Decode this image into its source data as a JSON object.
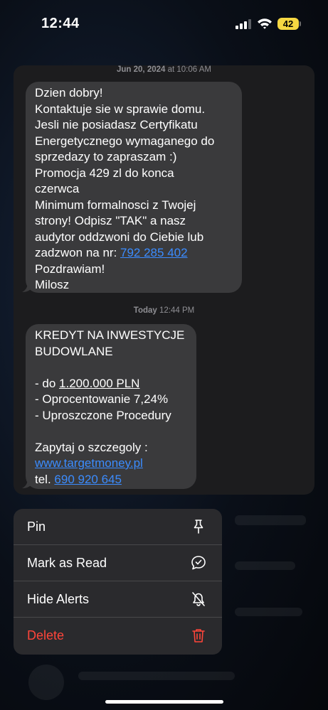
{
  "status_bar": {
    "time": "12:44",
    "battery": "42"
  },
  "conversation": {
    "timestamp_1": {
      "date": "Jun 20, 2024",
      "at": " at 10:06 AM"
    },
    "message_1": {
      "lines": [
        "Dzien dobry!",
        "Kontaktuje sie w sprawie domu.",
        "Jesli nie posiadasz Certyfikatu",
        "Energetycznego wymaganego do",
        "sprzedazy to zapraszam :)",
        "Promocja 429 zl do konca",
        "czerwca",
        "Minimum formalnosci z Twojej",
        "strony! Odpisz \"TAK\" a nasz",
        "audytor oddzwoni do Ciebie lub"
      ],
      "phone_prefix": "zadzwon na nr: ",
      "phone": "792 285 402",
      "closing": "Pozdrawiam!",
      "signature": "Milosz"
    },
    "timestamp_2": {
      "date": "Today",
      "time": " 12:44 PM"
    },
    "message_2": {
      "line_1": "KREDYT NA INWESTYCJE",
      "line_2": "BUDOWLANE",
      "bullet_1_prefix": "- do ",
      "bullet_1_amount": "1.200.000 PLN",
      "bullet_2": "- Oprocentowanie 7,24%",
      "bullet_3": "- Uproszczone Procedury",
      "ask": "Zapytaj o szczegoly :",
      "link": "www.targetmoney.pl",
      "tel_prefix": "tel. ",
      "tel": "690 920 645"
    }
  },
  "context_menu": {
    "items": [
      {
        "label": "Pin",
        "icon": "pin-icon"
      },
      {
        "label": "Mark as Read",
        "icon": "message-check-icon"
      },
      {
        "label": "Hide Alerts",
        "icon": "bell-slash-icon"
      },
      {
        "label": "Delete",
        "icon": "trash-icon",
        "color": "#ff453a"
      }
    ]
  },
  "colors": {
    "bubble": "#3a3a3c",
    "link": "#3b8cff",
    "destructive": "#ff453a",
    "battery": "#f5d742"
  }
}
